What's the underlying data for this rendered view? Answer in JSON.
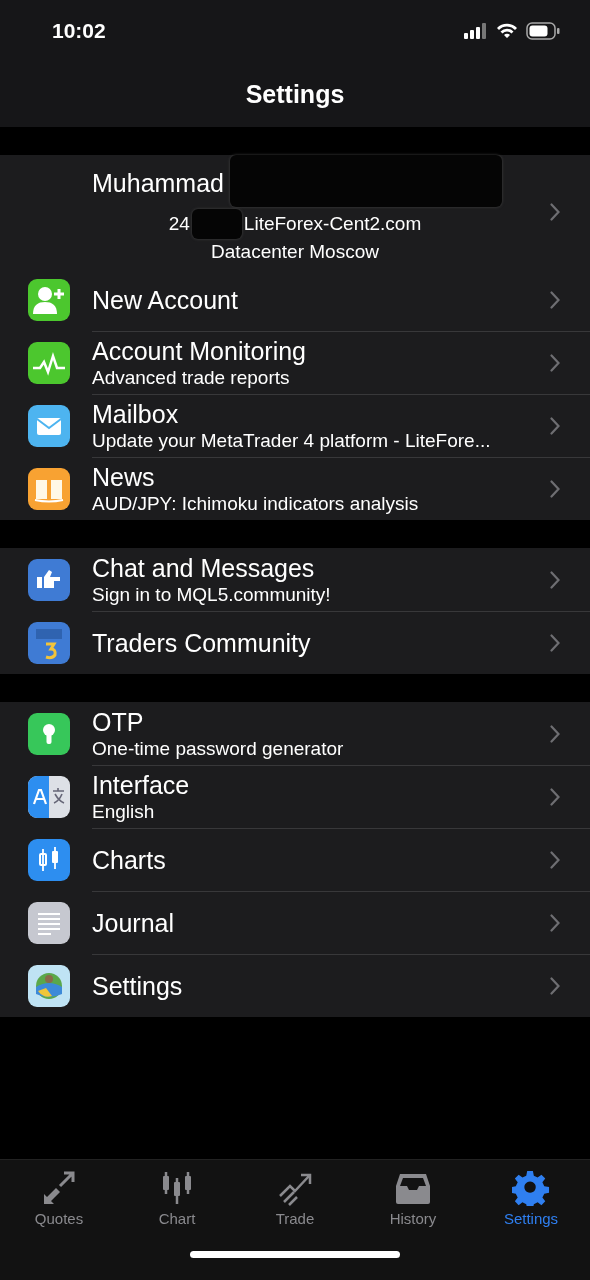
{
  "status_bar": {
    "time": "10:02"
  },
  "nav": {
    "title": "Settings"
  },
  "account": {
    "name": "Muhammad",
    "account_prefix": "24",
    "server": "LiteForex-Cent2.com",
    "datacenter": "Datacenter Moscow"
  },
  "groups": [
    {
      "items": [
        {
          "title": "New Account"
        },
        {
          "title": "Account Monitoring",
          "subtitle": "Advanced trade reports"
        },
        {
          "title": "Mailbox",
          "subtitle": "Update your MetaTrader 4 platform - LiteFore..."
        },
        {
          "title": "News",
          "subtitle": "AUD/JPY: Ichimoku indicators analysis"
        }
      ]
    },
    {
      "items": [
        {
          "title": "Chat and Messages",
          "subtitle": "Sign in to MQL5.community!"
        },
        {
          "title": "Traders Community"
        }
      ]
    },
    {
      "items": [
        {
          "title": "OTP",
          "subtitle": "One-time password generator"
        },
        {
          "title": "Interface",
          "subtitle": "English"
        },
        {
          "title": "Charts"
        },
        {
          "title": "Journal"
        },
        {
          "title": "Settings"
        }
      ]
    }
  ],
  "tabs": [
    {
      "label": "Quotes",
      "selected": false
    },
    {
      "label": "Chart",
      "selected": false
    },
    {
      "label": "Trade",
      "selected": false
    },
    {
      "label": "History",
      "selected": false
    },
    {
      "label": "Settings",
      "selected": true
    }
  ]
}
